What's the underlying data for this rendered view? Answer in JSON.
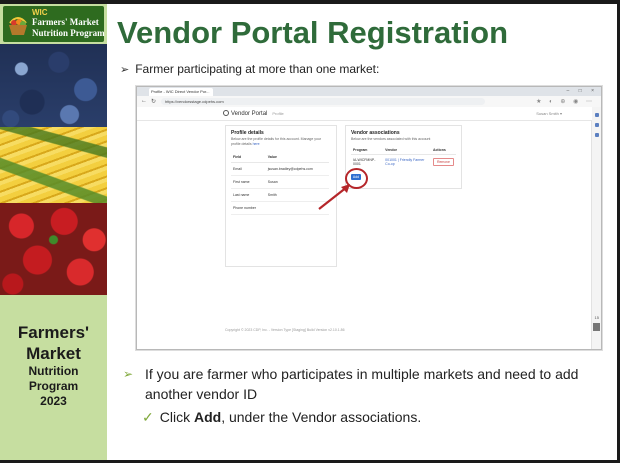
{
  "sidebar": {
    "logo": {
      "wic": "WIC",
      "line1": "Farmers' Market",
      "line2": "Nutrition Program"
    },
    "title_line1": "Farmers'",
    "title_line2": "Market",
    "title_line3": "Nutrition",
    "title_line4": "Program",
    "title_line5": "2023"
  },
  "slide": {
    "title": "Vendor Portal Registration",
    "bullet1": "Farmer participating at more than one market:",
    "bullet2": "If you are farmer who participates in multiple markets and need to add another vendor ID",
    "bullet3_pre": "Click ",
    "bullet3_bold": "Add",
    "bullet3_post": ", under the Vendor associations."
  },
  "screenshot": {
    "browser": {
      "tab_label": "Profile - WIC Direct Vendor Por...",
      "url": "https://vendorsstage.cdpehs.com",
      "window_controls": "–  □  ×"
    },
    "app": {
      "brand": "Vendor Portal",
      "breadcrumb": "Profile",
      "user_menu": "Susan Smith ▾"
    },
    "profile_card": {
      "title": "Profile details",
      "description": "Below are the profile details for this account. Manage your profile details",
      "description_link": "here",
      "columns": [
        "Field",
        "Value"
      ],
      "rows": [
        {
          "field": "Email",
          "value": "jsusan.bradley@cdpehs.com"
        },
        {
          "field": "First name",
          "value": "Susan"
        },
        {
          "field": "Last name",
          "value": "Smith"
        },
        {
          "field": "Phone number",
          "value": ""
        }
      ]
    },
    "vendor_card": {
      "title": "Vendor associations",
      "description": "Below are the vendors associated with this account",
      "columns": [
        "Program",
        "Vendor",
        "Actions"
      ],
      "rows": [
        {
          "program": "IA-WICFMNP-0001",
          "vendor": "001001 | Friendly Farmer Co-op",
          "action": "Remove"
        }
      ],
      "add_label": "Add"
    },
    "footer": "Copyright © 2023 CDP, Inc. - Version Type [Staging] Build Version v2.10.1.86",
    "corner_number": "15"
  }
}
